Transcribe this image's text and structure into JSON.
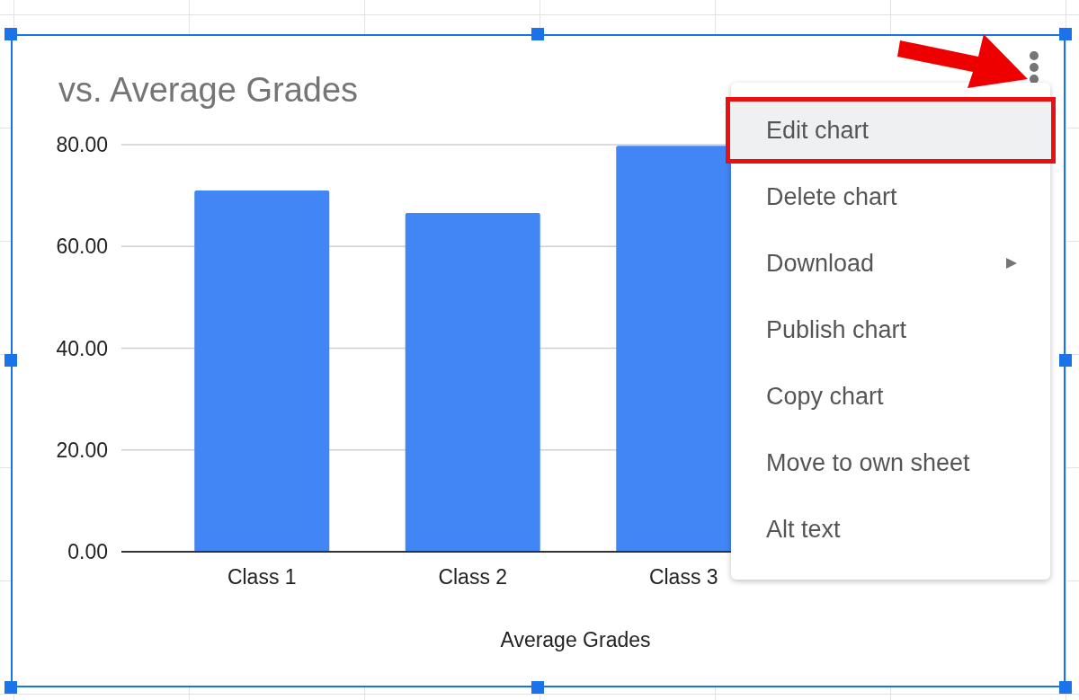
{
  "chart": {
    "chart_data": {
      "type": "bar",
      "title": "vs. Average Grades",
      "xlabel": "Average Grades",
      "categories": [
        "Class 1",
        "Class 2",
        "Class 3"
      ],
      "values": [
        71.0,
        66.6,
        79.8
      ],
      "ylim": [
        0,
        80
      ],
      "grid": true,
      "yticks": [
        {
          "value": 0,
          "label": "0.00"
        },
        {
          "value": 20,
          "label": "20.00"
        },
        {
          "value": 40,
          "label": "40.00"
        },
        {
          "value": 60,
          "label": "60.00"
        },
        {
          "value": 80,
          "label": "80.00"
        }
      ]
    }
  },
  "menu": {
    "items": [
      {
        "label": "Edit chart",
        "selected": true,
        "has_submenu": false
      },
      {
        "label": "Delete chart",
        "selected": false,
        "has_submenu": false
      },
      {
        "label": "Download",
        "selected": false,
        "has_submenu": true
      },
      {
        "label": "Publish chart",
        "selected": false,
        "has_submenu": false
      },
      {
        "label": "Copy chart",
        "selected": false,
        "has_submenu": false
      },
      {
        "label": "Move to own sheet",
        "selected": false,
        "has_submenu": false
      },
      {
        "label": "Alt text",
        "selected": false,
        "has_submenu": false
      }
    ]
  }
}
